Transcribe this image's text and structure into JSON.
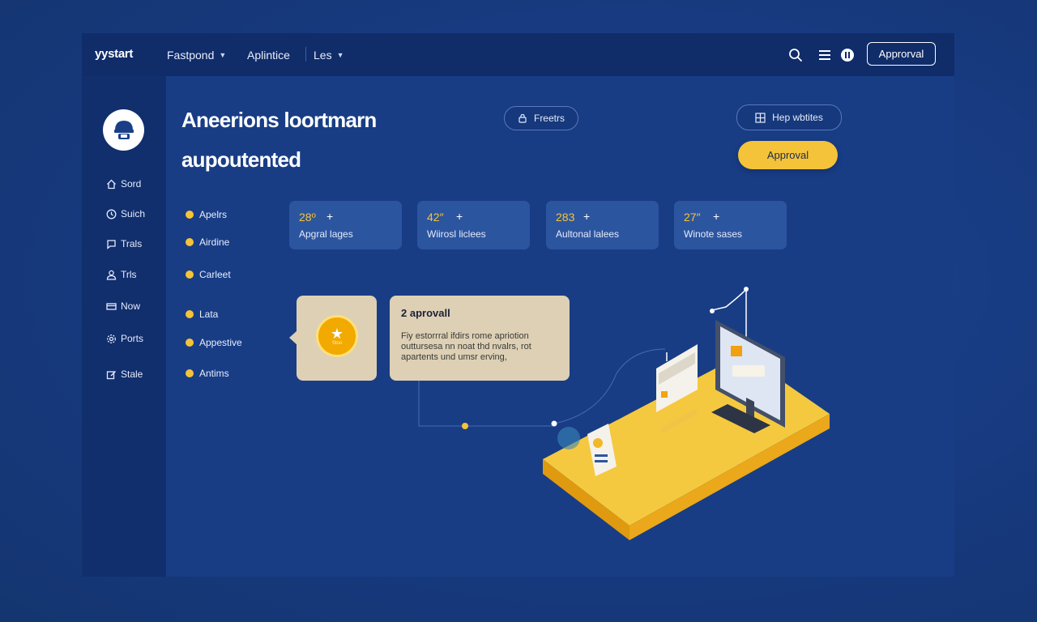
{
  "header": {
    "brand": "ystart",
    "nav": [
      {
        "label": "Fastpond",
        "has_dropdown": true
      },
      {
        "label": "Aplintice",
        "has_dropdown": false
      },
      {
        "label": "Les",
        "has_dropdown": true
      }
    ],
    "icons": [
      "search-icon",
      "menu-icon",
      "info-icon"
    ],
    "approval_button": "Approrval"
  },
  "sidebar": {
    "avatar_icon": "helmet-icon",
    "items": [
      {
        "label": "Sord",
        "icon": "home-icon"
      },
      {
        "label": "Suich",
        "icon": "clock-icon"
      },
      {
        "label": "Trals",
        "icon": "chat-icon"
      },
      {
        "label": "Trls",
        "icon": "user-icon"
      },
      {
        "label": "Now",
        "icon": "card-icon"
      },
      {
        "label": "Ports",
        "icon": "gear-icon"
      },
      {
        "label": "Stale",
        "icon": "edit-icon"
      }
    ]
  },
  "main": {
    "title_line1": "Aneerions loortmarn",
    "title_line2": "aupoutented",
    "freetrs_button": "Freetrs",
    "help_button": "Hep wbtites",
    "approval_cta": "Approval",
    "list": [
      "Apelrs",
      "Airdine",
      "Carleet",
      "Lata",
      "Appestive",
      "Antims"
    ],
    "stats": [
      {
        "value": "28º",
        "plus": "+",
        "label": "Apgral lages"
      },
      {
        "value": "42″",
        "plus": "+",
        "label": "Wiirosl liclees"
      },
      {
        "value": "283",
        "plus": "+",
        "label": "Aultonal lalees"
      },
      {
        "value": "27″",
        "plus": "+",
        "label": "Winote sases"
      }
    ],
    "badge_text": "Stoo",
    "approval_card": {
      "title": "2 aprovall",
      "text": "Fiy estorrral ifdirs rome apriotion outtursesa nn noat thd nvalrs, rot apartents und umsr erving,"
    }
  },
  "colors": {
    "page_bg": "#1a3f86",
    "topbar": "#102c69",
    "sidebar": "#112e6d",
    "stat_card": "#2c55a0",
    "accent_yellow": "#f4c33a",
    "card_beige": "#ddd0b4"
  }
}
